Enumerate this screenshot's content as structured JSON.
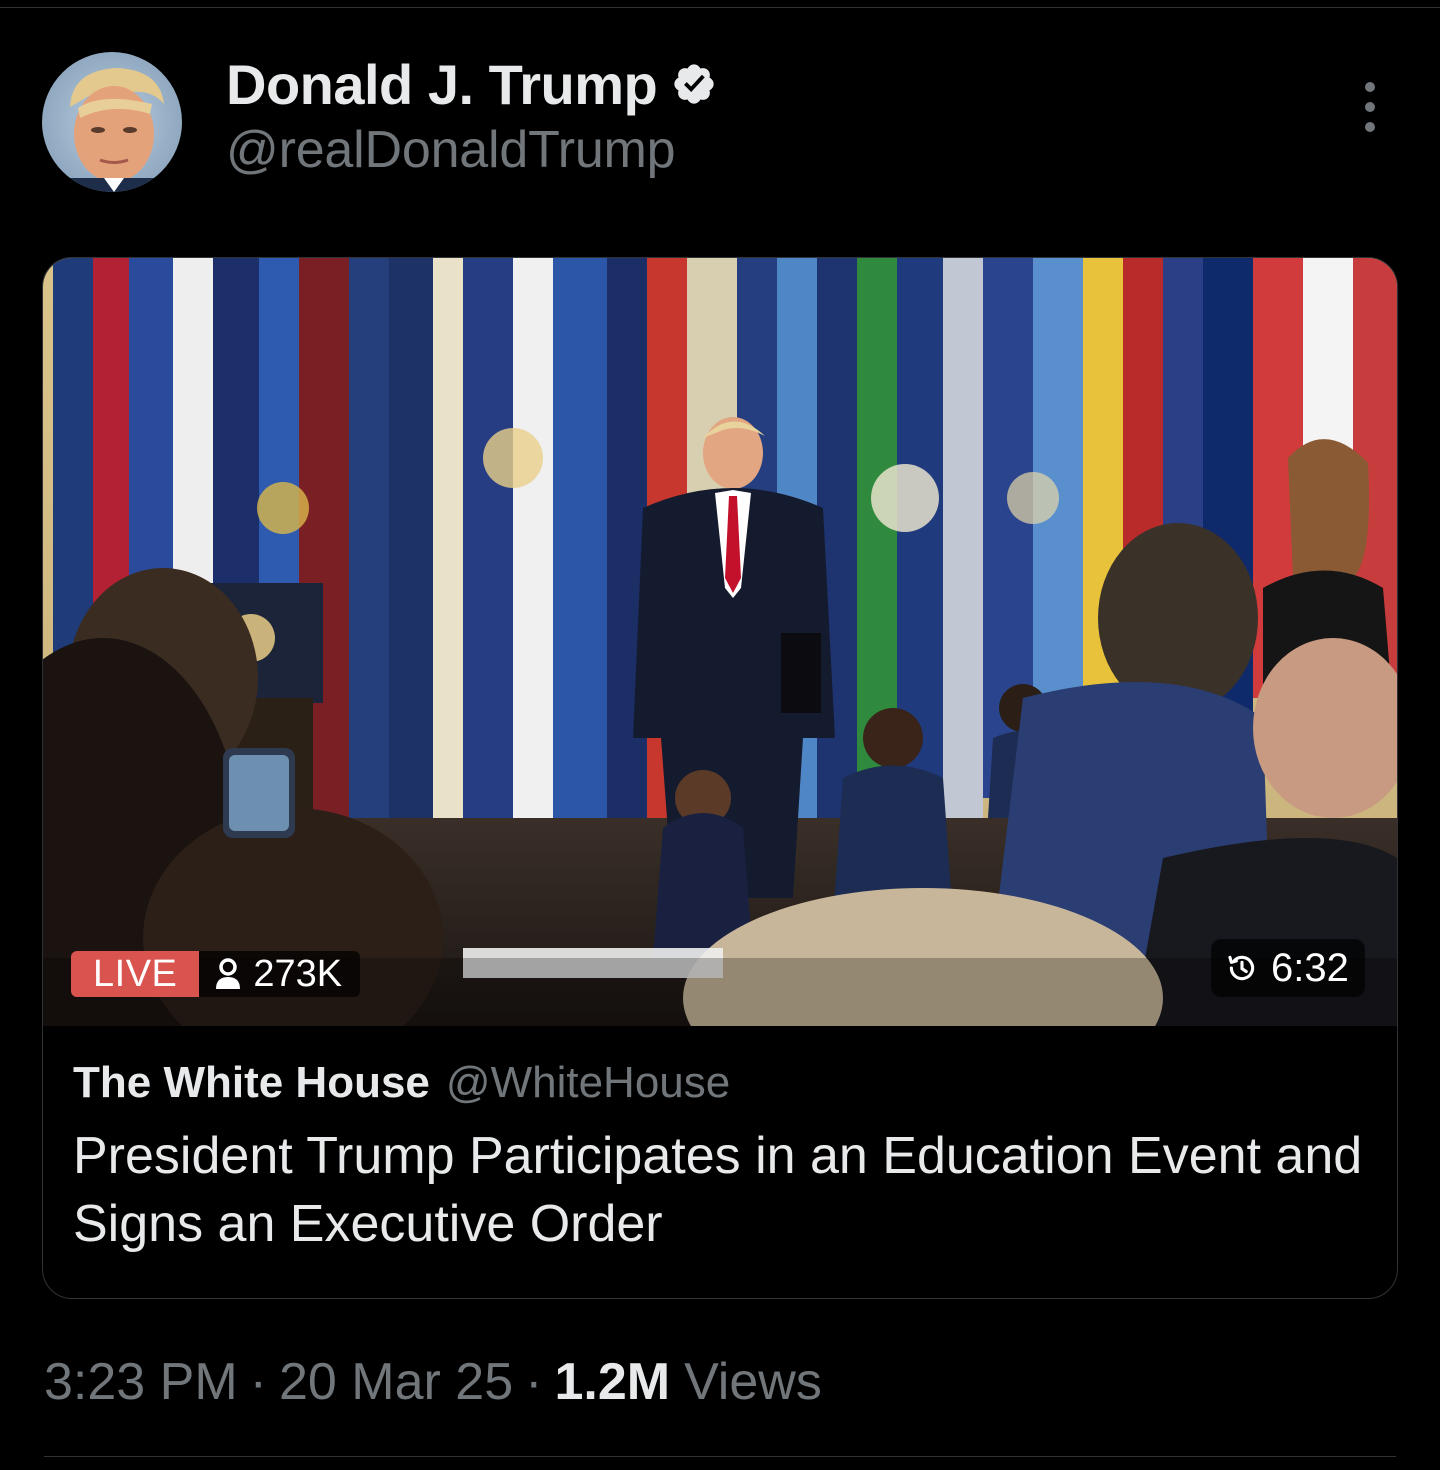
{
  "tweet": {
    "author": {
      "display_name": "Donald J. Trump",
      "handle": "@realDonaldTrump",
      "verified": true
    },
    "menu_icon": "more-vertical-icon",
    "card": {
      "live_label": "LIVE",
      "viewer_count": "273K",
      "viewer_icon": "person-icon",
      "duration": "6:32",
      "duration_icon": "history-clock-icon",
      "source_name": "The White House",
      "source_handle": "@WhiteHouse",
      "title": "President Trump Participates in an Education Event and Signs an Executive Order"
    },
    "time": "3:23 PM",
    "separator": "·",
    "date": "20 Mar 25",
    "views_count": "1.2M",
    "views_label": "Views"
  },
  "colors": {
    "background": "#000000",
    "primary_text": "#e7e9ea",
    "secondary_text": "#71767b",
    "border": "#2f3336",
    "live_badge": "#d9534f",
    "verified_badge": "#ffffff"
  }
}
